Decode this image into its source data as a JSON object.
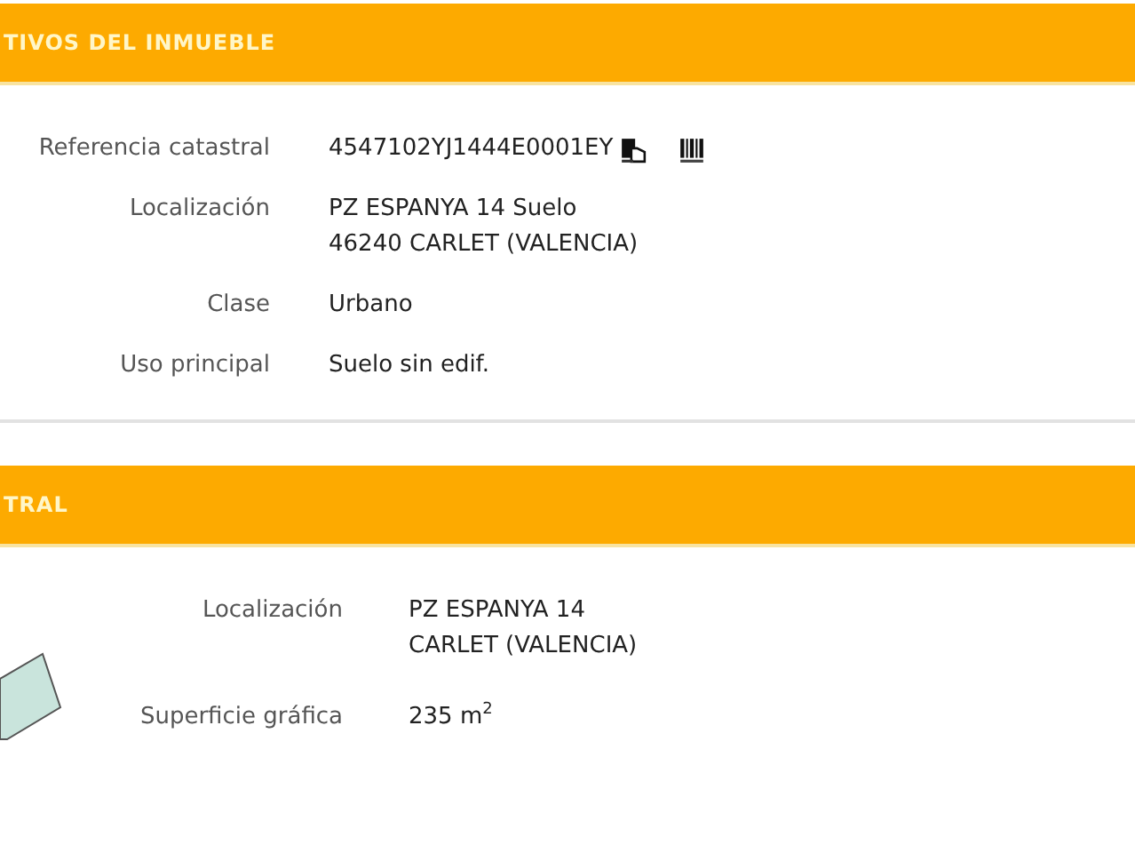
{
  "sections": [
    {
      "title": "TIVOS DEL INMUEBLE",
      "has_parcel": false,
      "rows": [
        {
          "label": "Referencia catastral",
          "lines": [
            "4547102YJ1444E0001EY"
          ],
          "icons": true
        },
        {
          "label": "Localización",
          "lines": [
            "PZ ESPANYA 14 Suelo",
            "46240 CARLET (VALENCIA)"
          ],
          "icons": false
        },
        {
          "label": "Clase",
          "lines": [
            "Urbano"
          ],
          "icons": false
        },
        {
          "label": "Uso principal",
          "lines": [
            "Suelo sin edif."
          ],
          "icons": false
        }
      ]
    },
    {
      "title": "TRAL",
      "has_parcel": true,
      "rows": [
        {
          "label": "Localización",
          "lines": [
            "PZ ESPANYA 14",
            "CARLET (VALENCIA)"
          ],
          "icons": false
        },
        {
          "label": "Superficie gráfica",
          "lines": [
            "235 m$^{2}$"
          ],
          "icons": false
        }
      ]
    }
  ]
}
